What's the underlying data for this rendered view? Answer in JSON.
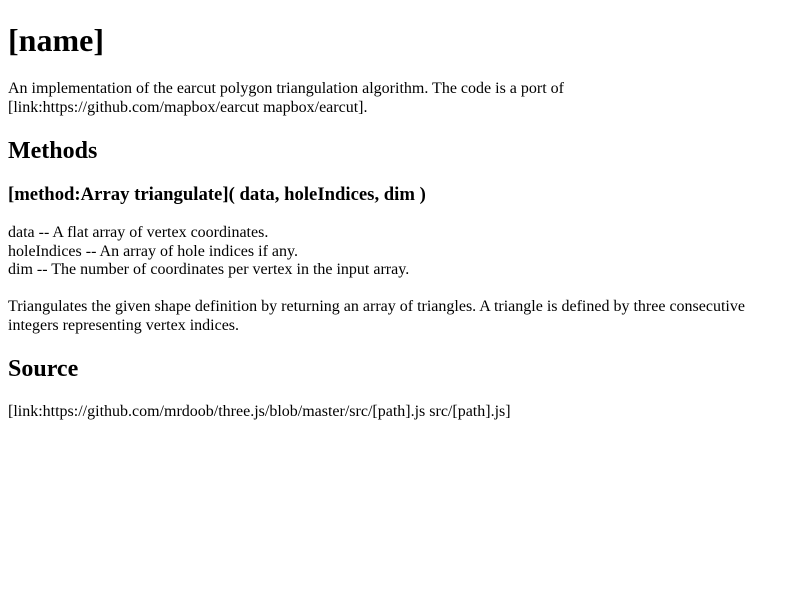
{
  "page": {
    "title": "[name]",
    "intro": "An implementation of the earcut polygon triangulation algorithm. The code is a port of [link:https://github.com/mapbox/earcut mapbox/earcut]."
  },
  "methods": {
    "heading": "Methods",
    "triangulate": {
      "signature": "[method:Array triangulate]( data, holeIndices, dim )",
      "params": [
        "data -- A flat array of vertex coordinates.",
        "holeIndices -- An array of hole indices if any.",
        "dim -- The number of coordinates per vertex in the input array."
      ],
      "description": "Triangulates the given shape definition by returning an array of triangles. A triangle is defined by three consecutive integers representing vertex indices."
    }
  },
  "source": {
    "heading": "Source",
    "link_text": "[link:https://github.com/mrdoob/three.js/blob/master/src/[path].js src/[path].js]"
  }
}
